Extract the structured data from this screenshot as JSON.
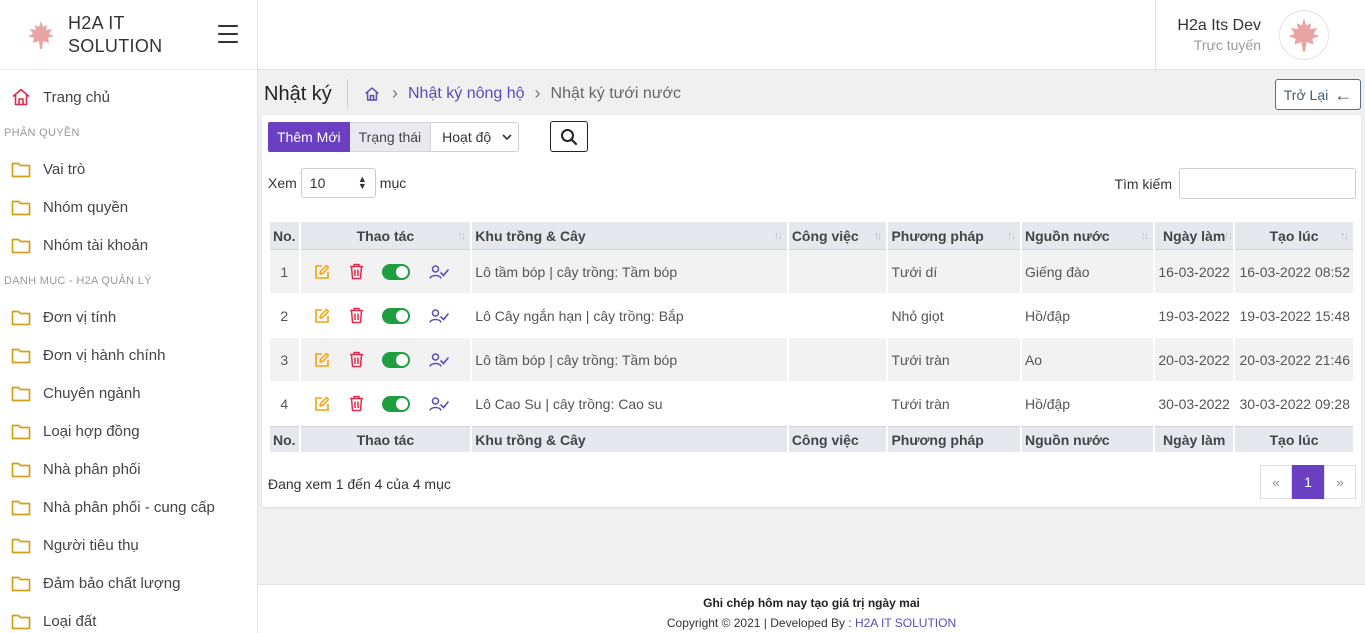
{
  "brand": {
    "line1": "H2A IT",
    "line2": "SOLUTION"
  },
  "user": {
    "name": "H2a Its Dev",
    "status": "Trực tuyến"
  },
  "sidebar": {
    "home": "Trang chủ",
    "section1": "PHÂN QUYỀN",
    "group1": [
      "Vai trò",
      "Nhóm quyền",
      "Nhóm tài khoản"
    ],
    "section2": "DANH MỤC - H2A QUẢN LÝ",
    "group2": [
      "Đơn vị tính",
      "Đơn vị hành chính",
      "Chuyên ngành",
      "Loại hợp đồng",
      "Nhà phân phối",
      "Nhà phân phối - cung cấp",
      "Người tiêu thụ",
      "Đảm bảo chất lượng",
      "Loại đất"
    ]
  },
  "page": {
    "title": "Nhật ký",
    "breadcrumb": [
      "Nhật ký nông hộ",
      "Nhật ký tưới nước"
    ],
    "back": "Trở Lại"
  },
  "toolbar": {
    "add": "Thêm Mới",
    "status_label": "Trạng thái",
    "status_value": "Hoạt độ"
  },
  "list": {
    "show": "Xem",
    "length": "10",
    "entries": "mục",
    "search_label": "Tìm kiếm"
  },
  "table": {
    "headers": [
      "No.",
      "Thao tác",
      "Khu trồng & Cây",
      "Công việc",
      "Phương pháp",
      "Nguồn nước",
      "Ngày làm",
      "Tạo lúc"
    ],
    "rows": [
      {
        "no": "1",
        "area": "Lô tầm bóp | cây trồng: Tầm bóp",
        "job": "",
        "method": "Tưới dí",
        "water": "Giếng đào",
        "date": "16-03-2022",
        "created": "16-03-2022 08:52"
      },
      {
        "no": "2",
        "area": "Lô Cây ngắn hạn | cây trồng: Bắp",
        "job": "",
        "method": "Nhỏ giọt",
        "water": "Hồ/đập",
        "date": "19-03-2022",
        "created": "19-03-2022 15:48"
      },
      {
        "no": "3",
        "area": "Lô tầm bóp | cây trồng: Tầm bóp",
        "job": "",
        "method": "Tưới tràn",
        "water": "Ao",
        "date": "20-03-2022",
        "created": "20-03-2022 21:46"
      },
      {
        "no": "4",
        "area": "Lô Cao Su | cây trồng: Cao su",
        "job": "",
        "method": "Tưới tràn",
        "water": "Hồ/đập",
        "date": "30-03-2022",
        "created": "30-03-2022 09:28"
      }
    ]
  },
  "info": "Đang xem 1 đến 4 của 4 mục",
  "pager": {
    "prev": "«",
    "current": "1",
    "next": "»"
  },
  "footer": {
    "slogan": "Ghi chép hôm nay tạo giá trị ngày mai",
    "copy": "Copyright © 2021 | Developed By :",
    "dev": "H2A IT SOLUTION"
  },
  "colors": {
    "accent": "#6a3fc2",
    "edit": "#f0a30a",
    "delete": "#e02b4b",
    "toggle": "#1e9e3e",
    "link": "#5b4bb5"
  },
  "icons": {
    "home": "home-icon",
    "folder": "folder-icon",
    "menu": "hamburger-icon",
    "search": "search-icon",
    "edit": "edit-icon",
    "delete": "trash-icon",
    "assign": "user-check-icon",
    "back": "arrow-left-icon"
  }
}
